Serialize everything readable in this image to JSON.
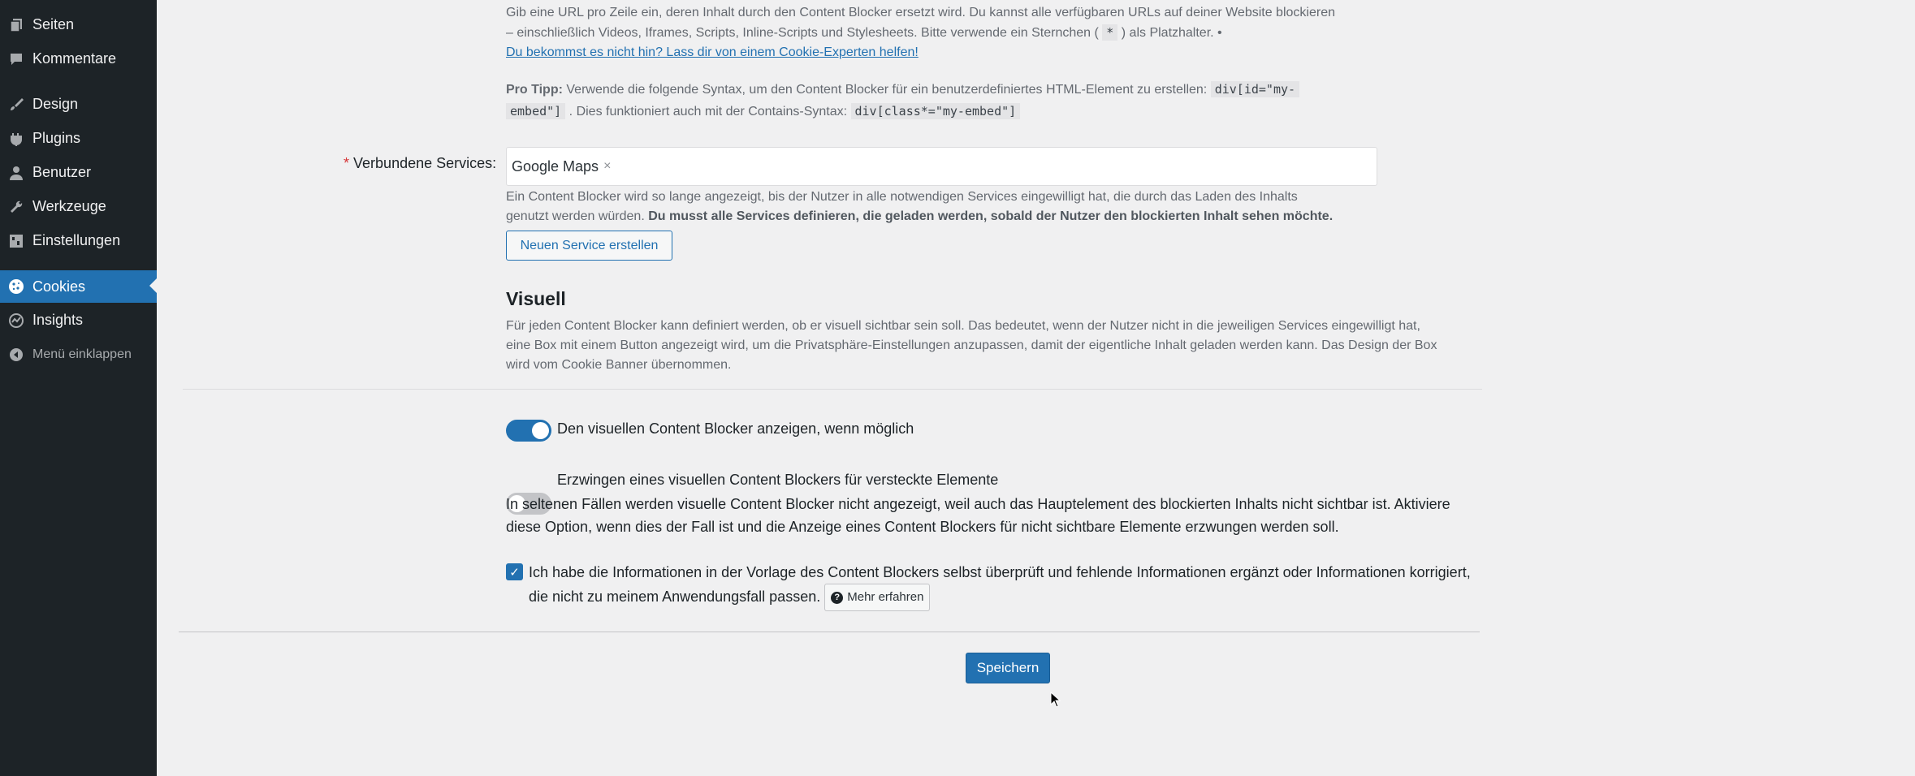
{
  "sidebar": {
    "items": [
      {
        "label": "Seiten",
        "icon": "pages-icon"
      },
      {
        "label": "Kommentare",
        "icon": "comments-icon"
      },
      {
        "label": "Design",
        "icon": "brush-icon"
      },
      {
        "label": "Plugins",
        "icon": "plugin-icon"
      },
      {
        "label": "Benutzer",
        "icon": "user-icon"
      },
      {
        "label": "Werkzeuge",
        "icon": "wrench-icon"
      },
      {
        "label": "Einstellungen",
        "icon": "settings-icon"
      },
      {
        "label": "Cookies",
        "icon": "cookie-icon",
        "active": true
      },
      {
        "label": "Insights",
        "icon": "insights-icon"
      }
    ],
    "collapse_label": "Menü einklappen"
  },
  "url_field": {
    "desc_line1": "Gib eine URL pro Zeile ein, deren Inhalt durch den Content Blocker ersetzt wird. Du kannst alle verfügbaren URLs auf deiner Website blockieren",
    "desc_line2_a": "– einschließlich Videos, Iframes, Scripts, Inline-Scripts und Stylesheets. Bitte verwende ein Sternchen (",
    "desc_line2_code": "*",
    "desc_line2_b": ") als Platzhalter. •",
    "help_link": "Du bekommst es nicht hin? Lass dir von einem Cookie-Experten helfen!",
    "pro_tip_label": "Pro Tipp:",
    "pro_tip_text": "Verwende die folgende Syntax, um den Content Blocker für ein benutzerdefiniertes HTML-Element zu erstellen:",
    "pro_tip_code1_a": "div[id=\"my-",
    "pro_tip_code1_b": "embed\"]",
    "pro_tip_text2": ". Dies funktioniert auch mit der Contains-Syntax:",
    "pro_tip_code2": "div[class*=\"my-embed\"]"
  },
  "services": {
    "required_mark": "*",
    "label": "Verbundene Services:",
    "tag": "Google Maps",
    "tag_remove": "×",
    "desc_line1": "Ein Content Blocker wird so lange angezeigt, bis der Nutzer in alle notwendigen Services eingewilligt hat, die durch das Laden des Inhalts",
    "desc_line2_a": "genutzt werden würden.",
    "desc_line2_b": "Du musst alle Services definieren, die geladen werden, sobald der Nutzer den blockierten Inhalt sehen möchte.",
    "new_service_button": "Neuen Service erstellen"
  },
  "visual": {
    "title": "Visuell",
    "desc_line1": "Für jeden Content Blocker kann definiert werden, ob er visuell sichtbar sein soll. Das bedeutet, wenn der Nutzer nicht in die jeweiligen Services eingewilligt hat,",
    "desc_line2": "eine Box mit einem Button angezeigt wird, um die Privatsphäre-Einstellungen anzupassen, damit der eigentliche Inhalt geladen werden kann. Das Design der Box",
    "desc_line3": "wird vom Cookie Banner übernommen.",
    "toggle1_label": "Den visuellen Content Blocker anzeigen, wenn möglich",
    "toggle1_on": true,
    "toggle2_label": "Erzwingen eines visuellen Content Blockers für versteckte Elemente",
    "toggle2_on": false,
    "toggle2_desc_line1": "In seltenen Fällen werden visuelle Content Blocker nicht angezeigt, weil auch das Hauptelement des blockierten Inhalts nicht sichtbar ist. Aktiviere",
    "toggle2_desc_line2": "diese Option, wenn dies der Fall ist und die Anzeige eines Content Blockers für nicht sichtbare Elemente erzwungen werden soll.",
    "checkbox_checked": true,
    "checkbox_label_line1": "Ich habe die Informationen in der Vorlage des Content Blockers selbst überprüft und fehlende Informationen ergänzt oder Informationen korrigiert,",
    "checkbox_label_line2": "die nicht zu meinem Anwendungsfall passen.",
    "learn_more": "Mehr erfahren"
  },
  "save_button": "Speichern",
  "colors": {
    "accent": "#2271b1",
    "sidebar_bg": "#1d2327",
    "page_bg": "#f0f0f1"
  }
}
